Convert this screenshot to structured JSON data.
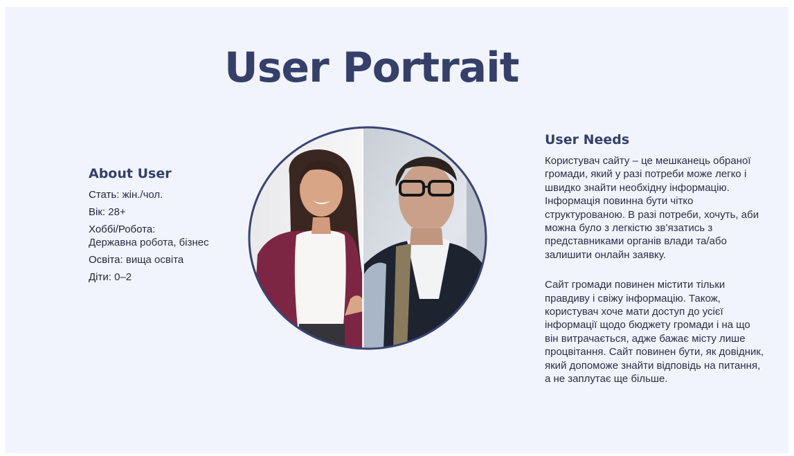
{
  "title": "User Portrait",
  "about": {
    "heading": "About User",
    "facts": [
      {
        "label": "Стать",
        "value": "жін./чол."
      },
      {
        "label": "Вік",
        "value": "28+"
      },
      {
        "label": "Хоббі/Робота",
        "value": "Державна робота, бізнес"
      },
      {
        "label": "Освіта",
        "value": "вища освіта"
      },
      {
        "label": "Діти",
        "value": "0–2"
      }
    ]
  },
  "needs": {
    "heading": "User Needs",
    "paragraphs": [
      "Користувач сайту – це мешканець обраної громади, який у разі потреби може легко і швидко знайти необхідну інформацію. Інформація повинна бути чітко структурованою. В разі потреби, хочуть, аби можна було з легкістю зв’язатись з представниками органів влади та/або залишити онлайн заявку.",
      "Сайт громади повинен містити тільки правдиву і свіжу інформацію. Також, користувач хоче мати доступ до усієї інформації щодо бюджету громади і на що він витрачається, адже бажає місту лише процвітання. Сайт повинен бути, як довідник, який допоможе знайти відповідь на питання, а не заплутає ще більше."
    ]
  },
  "colors": {
    "background": "#f1f4fd",
    "heading": "#353f68",
    "text": "#2a2e45",
    "ring": "#3a4372"
  }
}
